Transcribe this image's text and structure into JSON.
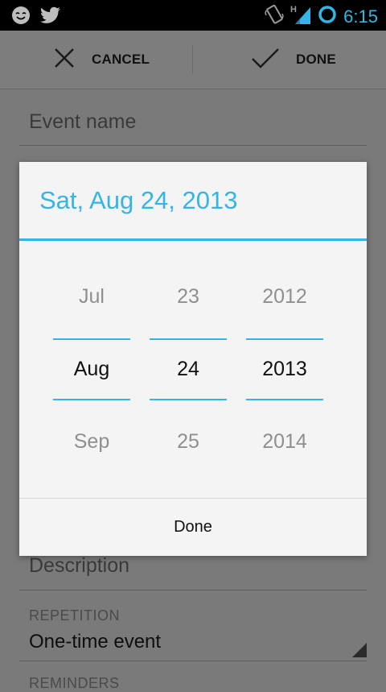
{
  "status_bar": {
    "time": "6:15",
    "icons": [
      "smiley-notification-icon",
      "twitter-icon",
      "vibrate-icon",
      "hspa-signal-icon",
      "battery-ring-icon"
    ],
    "accent": "#33b5e5"
  },
  "action_bar": {
    "cancel_label": "CANCEL",
    "done_label": "DONE"
  },
  "form": {
    "event_name_placeholder": "Event name",
    "description_placeholder": "Description",
    "repetition_label": "REPETITION",
    "repetition_value": "One-time event",
    "reminders_label": "REMINDERS"
  },
  "date_dialog": {
    "title": "Sat, Aug 24, 2013",
    "month": {
      "prev": "Jul",
      "current": "Aug",
      "next": "Sep"
    },
    "day": {
      "prev": "23",
      "current": "24",
      "next": "25"
    },
    "year": {
      "prev": "2012",
      "current": "2013",
      "next": "2014"
    },
    "done_label": "Done",
    "accent": "#33b5e5"
  }
}
